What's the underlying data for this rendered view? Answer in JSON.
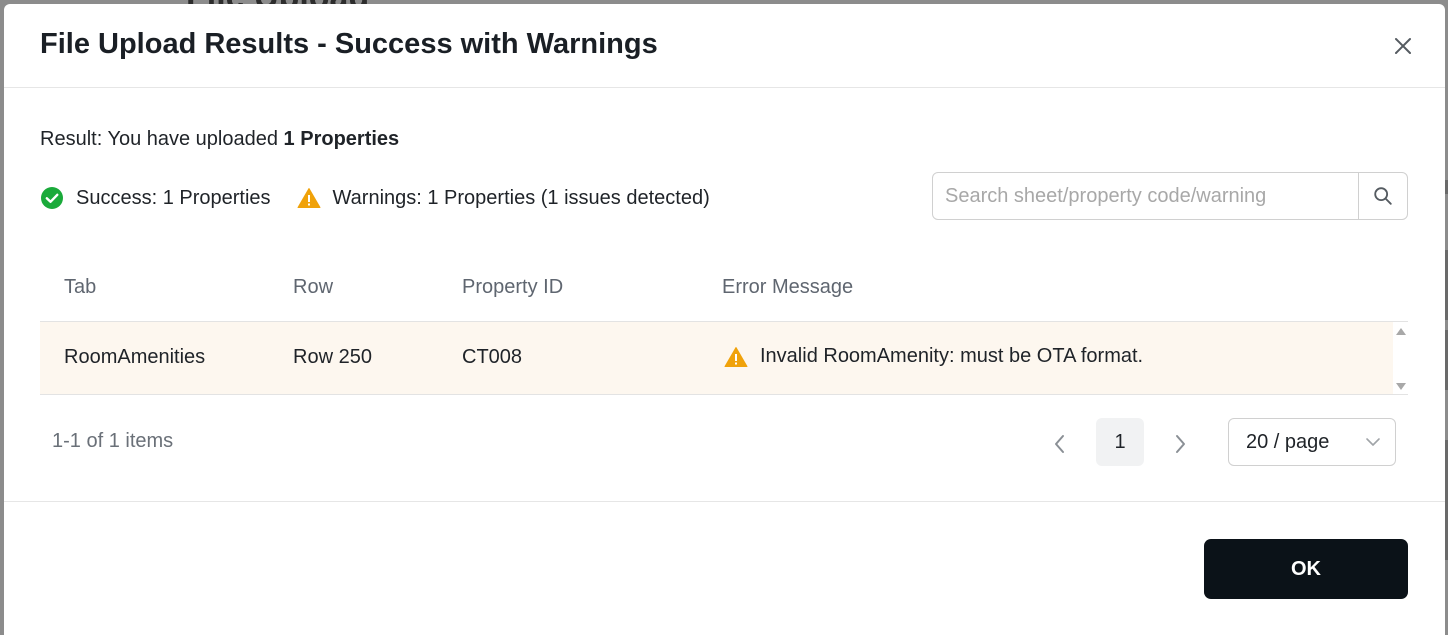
{
  "background": {
    "page_title": "File Upload"
  },
  "modal": {
    "title": "File Upload Results - Success with Warnings",
    "result_prefix": "Result: You have uploaded ",
    "result_count": "1 Properties",
    "success_text": "Success: 1 Properties",
    "warning_text": "Warnings: 1 Properties (1 issues detected)",
    "search_placeholder": "Search sheet/property code/warning",
    "search_value": ""
  },
  "table": {
    "columns": [
      "Tab",
      "Row",
      "Property ID",
      "Error Message"
    ],
    "rows": [
      {
        "tab": "RoomAmenities",
        "row": "Row 250",
        "property_id": "CT008",
        "error_message": "Invalid RoomAmenity: must be OTA format."
      }
    ]
  },
  "pagination": {
    "summary": "1-1 of 1 items",
    "current_page": "1",
    "page_size": "20 / page"
  },
  "footer": {
    "ok_label": "OK"
  },
  "icons": {
    "close": "close-icon",
    "success": "check-circle-icon",
    "warning": "warning-triangle-icon",
    "search": "search-icon",
    "prev": "chevron-left-icon",
    "next": "chevron-right-icon",
    "dropdown": "chevron-down-icon"
  },
  "colors": {
    "success": "#1aaa3a",
    "warning": "#f0a20a",
    "row_highlight": "#fdf7ef",
    "primary_button": "#0b1218"
  }
}
